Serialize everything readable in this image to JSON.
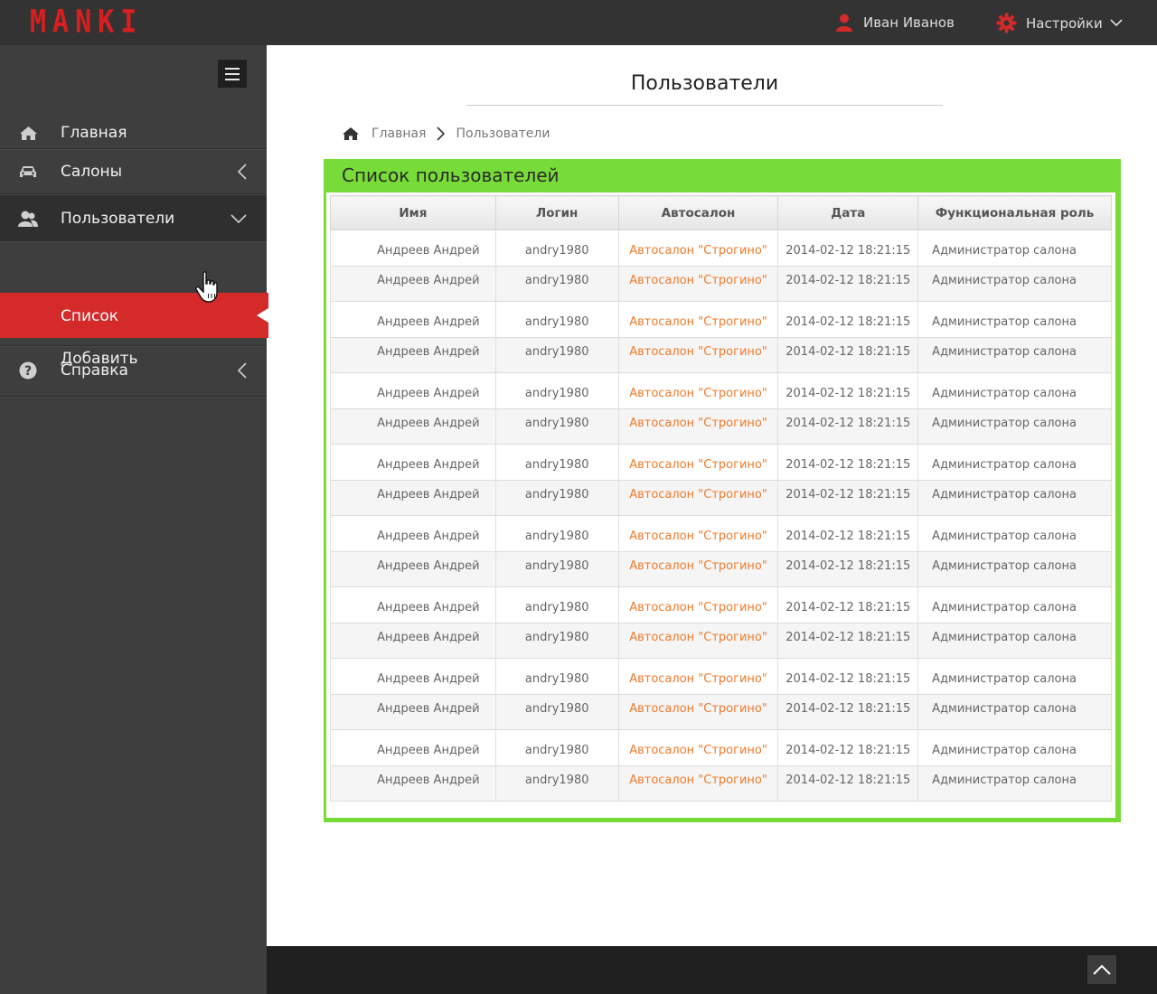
{
  "header": {
    "logo": "MANKI",
    "user_name": "Иван Иванов",
    "settings_label": "Настройки"
  },
  "sidebar": {
    "items": [
      {
        "label": "Главная",
        "icon": "home-icon"
      },
      {
        "label": "Салоны",
        "icon": "car-icon"
      },
      {
        "label": "Пользователи",
        "icon": "users-icon"
      },
      {
        "label": "Справка",
        "icon": "help-icon"
      }
    ],
    "subitems": [
      {
        "label": "Список"
      },
      {
        "label": "Добавить"
      }
    ]
  },
  "page": {
    "title": "Пользователи",
    "breadcrumb": [
      "Главная",
      "Пользователи"
    ]
  },
  "panel": {
    "title": "Список пользователей",
    "columns": [
      "Имя",
      "Логин",
      "Автосалон",
      "Дата",
      "Функциональная роль"
    ],
    "rows": [
      [
        "Андреев Андрей",
        "andry1980",
        "Автосалон \"Строгино\"",
        "2014-02-12 18:21:15",
        "Администратор салона"
      ],
      [
        "Андреев Андрей",
        "andry1980",
        "Автосалон \"Строгино\"",
        "2014-02-12 18:21:15",
        "Администратор салона"
      ],
      [
        "Андреев Андрей",
        "andry1980",
        "Автосалон \"Строгино\"",
        "2014-02-12 18:21:15",
        "Администратор салона"
      ],
      [
        "Андреев Андрей",
        "andry1980",
        "Автосалон \"Строгино\"",
        "2014-02-12 18:21:15",
        "Администратор салона"
      ],
      [
        "Андреев Андрей",
        "andry1980",
        "Автосалон \"Строгино\"",
        "2014-02-12 18:21:15",
        "Администратор салона"
      ],
      [
        "Андреев Андрей",
        "andry1980",
        "Автосалон \"Строгино\"",
        "2014-02-12 18:21:15",
        "Администратор салона"
      ],
      [
        "Андреев Андрей",
        "andry1980",
        "Автосалон \"Строгино\"",
        "2014-02-12 18:21:15",
        "Администратор салона"
      ],
      [
        "Андреев Андрей",
        "andry1980",
        "Автосалон \"Строгино\"",
        "2014-02-12 18:21:15",
        "Администратор салона"
      ],
      [
        "Андреев Андрей",
        "andry1980",
        "Автосалон \"Строгино\"",
        "2014-02-12 18:21:15",
        "Администратор салона"
      ],
      [
        "Андреев Андрей",
        "andry1980",
        "Автосалон \"Строгино\"",
        "2014-02-12 18:21:15",
        "Администратор салона"
      ],
      [
        "Андреев Андрей",
        "andry1980",
        "Автосалон \"Строгино\"",
        "2014-02-12 18:21:15",
        "Администратор салона"
      ],
      [
        "Андреев Андрей",
        "andry1980",
        "Автосалон \"Строгино\"",
        "2014-02-12 18:21:15",
        "Администратор салона"
      ],
      [
        "Андреев Андрей",
        "andry1980",
        "Автосалон \"Строгино\"",
        "2014-02-12 18:21:15",
        "Администратор салона"
      ],
      [
        "Андреев Андрей",
        "andry1980",
        "Автосалон \"Строгино\"",
        "2014-02-12 18:21:15",
        "Администратор салона"
      ],
      [
        "Андреев Андрей",
        "andry1980",
        "Автосалон \"Строгино\"",
        "2014-02-12 18:21:15",
        "Администратор салона"
      ],
      [
        "Андреев Андрей",
        "andry1980",
        "Автосалон \"Строгино\"",
        "2014-02-12 18:21:15",
        "Администратор салона"
      ]
    ]
  },
  "colors": {
    "brand_red": "#d71f1f",
    "active_red": "#d42a2a",
    "panel_green": "#77dc38",
    "link_orange": "#f07a2a",
    "topbar": "#333333",
    "sidebar": "#3e3e3e"
  },
  "footer": {
    "scroll_top_icon": "chevron-up-icon"
  }
}
